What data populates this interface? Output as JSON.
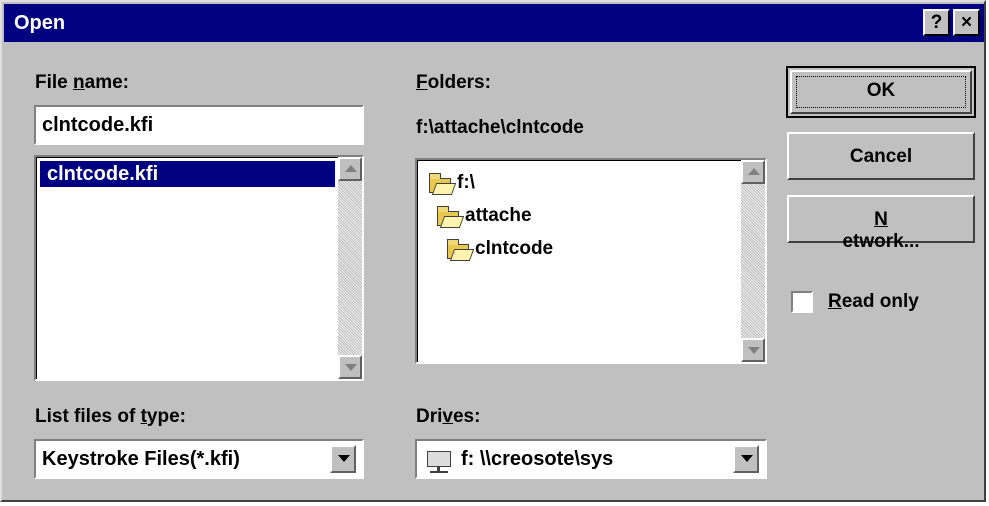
{
  "window": {
    "title": "Open",
    "help_glyph": "?",
    "close_glyph": "×"
  },
  "file_name": {
    "label_pre": "File ",
    "label_hot": "n",
    "label_post": "ame:",
    "value": "clntcode.kfi",
    "files": [
      "clntcode.kfi"
    ],
    "selected_index": 0
  },
  "folders": {
    "label_hot": "F",
    "label_post": "olders:",
    "current_path": "f:\\attache\\clntcode",
    "tree": [
      "f:\\",
      "attache",
      "clntcode"
    ]
  },
  "file_type": {
    "label_pre": "List files of ",
    "label_hot": "t",
    "label_post": "ype:",
    "value": "Keystroke Files(*.kfi)"
  },
  "drives": {
    "label_pre": "Dri",
    "label_hot": "v",
    "label_post": "es:",
    "value": "f: \\\\creosote\\sys"
  },
  "buttons": {
    "ok": "OK",
    "cancel": "Cancel",
    "network_hot": "N",
    "network_post": "etwork..."
  },
  "read_only": {
    "label_hot": "R",
    "label_post": "ead only",
    "checked": false
  },
  "colors": {
    "titlebar": "#000080",
    "face": "#c0c0c0",
    "selection": "#000080"
  }
}
